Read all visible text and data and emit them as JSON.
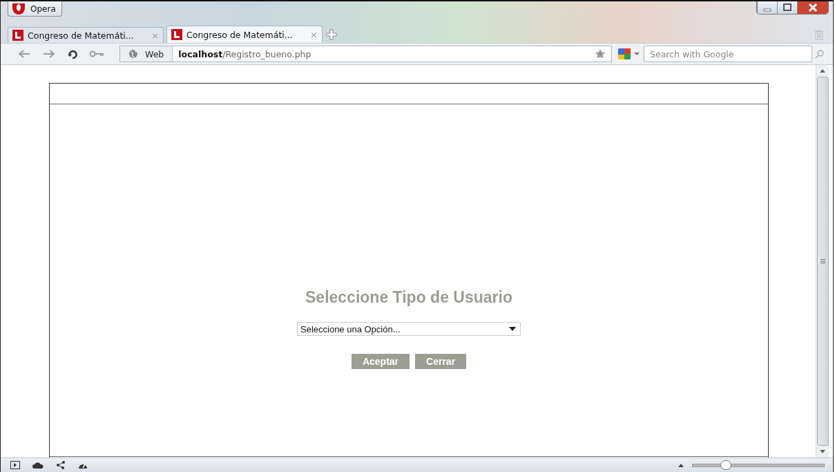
{
  "window": {
    "menu_button": "Opera"
  },
  "tabs": [
    {
      "label": "Congreso de Matemáti...",
      "close": "×",
      "selected": false
    },
    {
      "label": "Congreso de Matemáti...",
      "close": "×",
      "selected": true
    }
  ],
  "address_bar": {
    "site_label": "Web",
    "host": "localhost",
    "path": "/Registro_bueno.php"
  },
  "search": {
    "placeholder": "Search with Google"
  },
  "page": {
    "heading": "Seleccione Tipo de Usuario",
    "select": {
      "value": "Seleccione una Opción..."
    },
    "buttons": [
      "Aceptar",
      "Cerrar"
    ]
  },
  "status_bar": {
    "zoom": {
      "level": 0.25
    }
  }
}
